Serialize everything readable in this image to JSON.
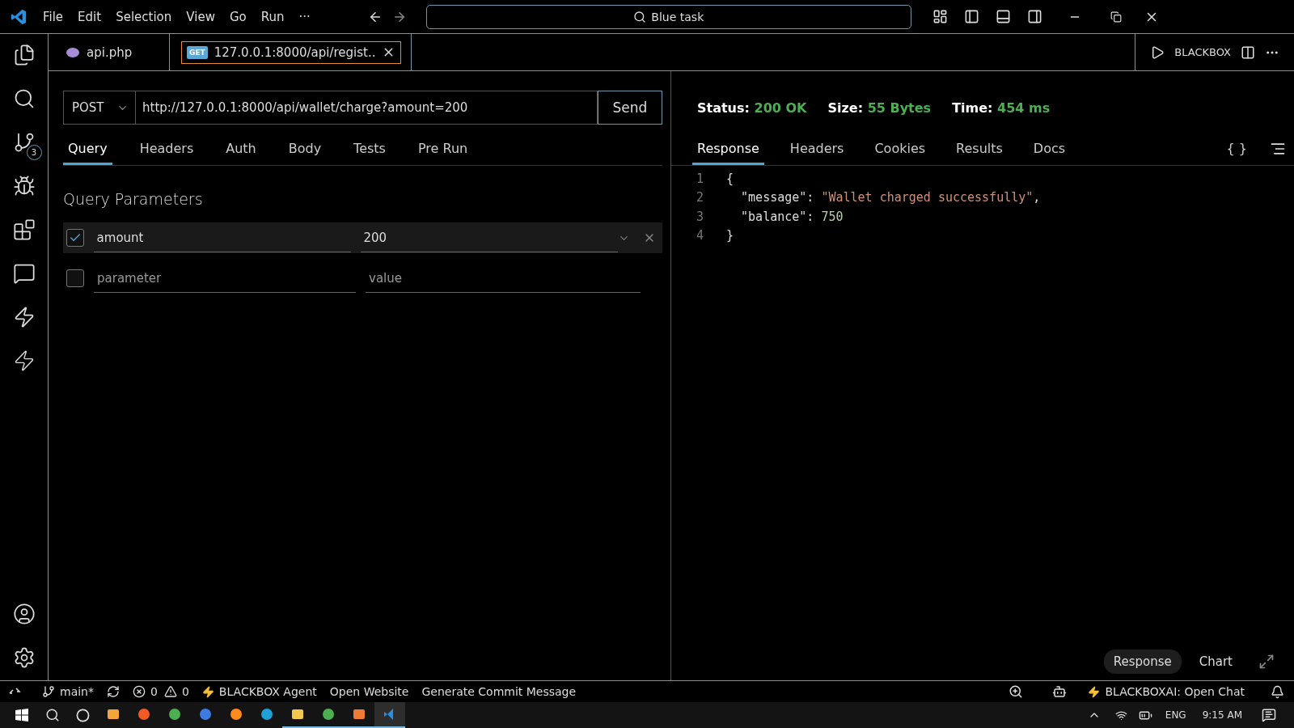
{
  "menu": [
    "File",
    "Edit",
    "Selection",
    "View",
    "Go",
    "Run",
    "···"
  ],
  "command_center": {
    "value": "Blue task"
  },
  "activity_bar": {
    "source_control_badge": "3"
  },
  "editor_tabs": [
    {
      "kind": "php",
      "label": "api.php",
      "selected": false
    },
    {
      "kind": "request",
      "badge": "GET",
      "label": "127.0.0.1:8000/api/regist..",
      "selected": true
    }
  ],
  "editor_actions": {
    "label": "BLACKBOX"
  },
  "request": {
    "method": "POST",
    "url": "http://127.0.0.1:8000/api/wallet/charge?amount=200",
    "send": "Send"
  },
  "request_tabs": [
    {
      "label": "Query",
      "selected": true
    },
    {
      "label": "Headers",
      "selected": false
    },
    {
      "label": "Auth",
      "selected": false
    },
    {
      "label": "Body",
      "selected": false
    },
    {
      "label": "Tests",
      "selected": false
    },
    {
      "label": "Pre Run",
      "selected": false
    }
  ],
  "section_title": "Query Parameters",
  "params": [
    {
      "checked": true,
      "name": {
        "value": "amount"
      },
      "value": {
        "value": "200"
      }
    },
    {
      "checked": false,
      "name": {
        "placeholder": "parameter"
      },
      "value": {
        "placeholder": "value"
      }
    }
  ],
  "response_stats": [
    {
      "label": "Status:",
      "value": "200 OK"
    },
    {
      "label": "Size:",
      "value": "55 Bytes"
    },
    {
      "label": "Time:",
      "value": "454 ms"
    }
  ],
  "response_tabs": [
    {
      "label": "Response",
      "selected": true
    },
    {
      "label": "Headers",
      "selected": false
    },
    {
      "label": "Cookies",
      "selected": false
    },
    {
      "label": "Results",
      "selected": false
    },
    {
      "label": "Docs",
      "selected": false
    }
  ],
  "format_button": "{ }",
  "code_lines": [
    {
      "number": "1",
      "tokens": [
        {
          "kind": "punct",
          "text": "{"
        }
      ]
    },
    {
      "number": "2",
      "tokens": [
        {
          "kind": "key",
          "text": "  \"message\""
        },
        {
          "kind": "punct",
          "text": ": "
        },
        {
          "kind": "string",
          "text": "\"Wallet charged successfully\""
        },
        {
          "kind": "punct",
          "text": ","
        }
      ]
    },
    {
      "number": "3",
      "tokens": [
        {
          "kind": "key",
          "text": "  \"balance\""
        },
        {
          "kind": "punct",
          "text": ": "
        },
        {
          "kind": "number",
          "text": "750"
        }
      ]
    },
    {
      "number": "4",
      "tokens": [
        {
          "kind": "punct",
          "text": "}"
        }
      ]
    }
  ],
  "view_toggle": [
    {
      "label": "Response",
      "selected": true
    },
    {
      "label": "Chart",
      "selected": false
    }
  ],
  "status_bar": {
    "branch": "main*",
    "errors": "0",
    "warnings": "0",
    "left_items": [
      "BLACKBOX Agent",
      "Open Website",
      "Generate Commit Message"
    ],
    "right_item": "BLACKBOXAI: Open Chat"
  },
  "taskbar": {
    "apps": [
      {
        "kind": "store",
        "running": false,
        "active": false
      },
      {
        "kind": "brave",
        "running": false,
        "active": false
      },
      {
        "kind": "chrome",
        "running": false,
        "active": false
      },
      {
        "kind": "compass",
        "running": false,
        "active": false
      },
      {
        "kind": "firefox",
        "running": false,
        "active": false
      },
      {
        "kind": "edge",
        "running": false,
        "active": false
      },
      {
        "kind": "folder",
        "running": true,
        "active": false
      },
      {
        "kind": "chrome",
        "running": true,
        "active": false
      },
      {
        "kind": "xampp",
        "running": true,
        "active": false
      },
      {
        "kind": "vscode",
        "running": true,
        "active": true
      }
    ],
    "language": "ENG",
    "time": "9:15 AM"
  }
}
